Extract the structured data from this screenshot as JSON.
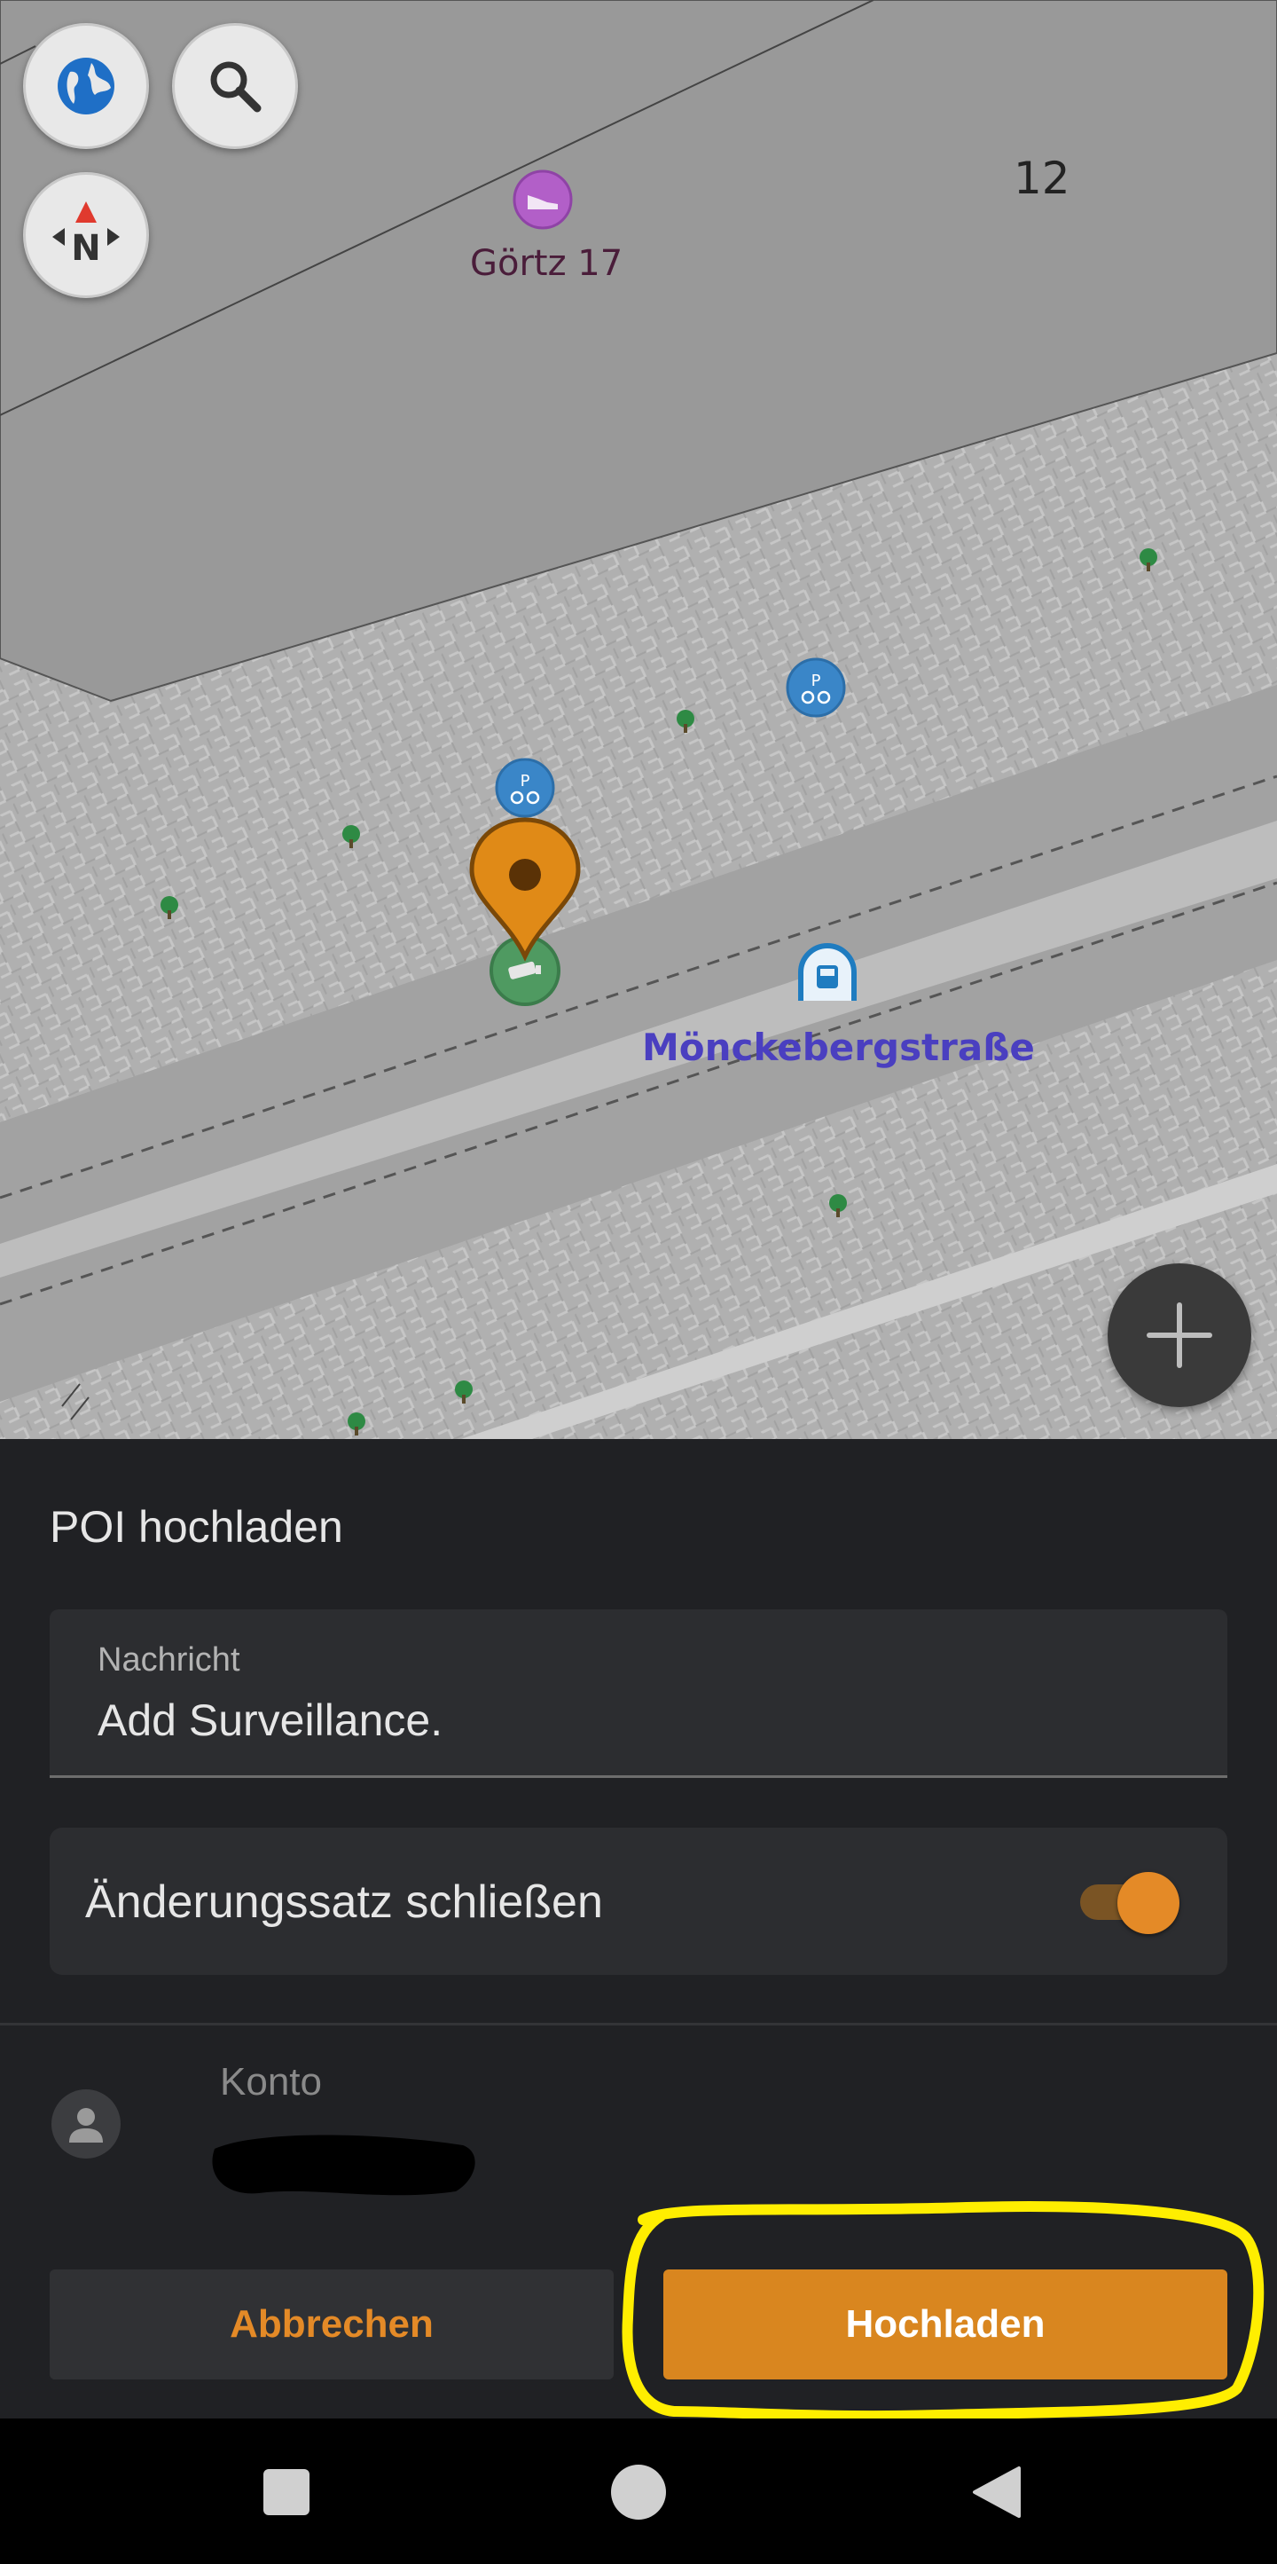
{
  "map": {
    "zoom_level": "12",
    "poi_shop_name": "Görtz 17",
    "station_name": "Mönckebergstraße",
    "controls": {
      "layers_icon": "globe-icon",
      "search_icon": "search-icon",
      "compass_icon": "compass-icon",
      "add_icon": "plus-icon"
    }
  },
  "sheet": {
    "title": "POI hochladen",
    "message_field": {
      "label": "Nachricht",
      "value": "Add Surveillance."
    },
    "close_changeset": {
      "label": "Änderungssatz schließen",
      "enabled": true
    },
    "account": {
      "label": "Konto"
    },
    "buttons": {
      "cancel": "Abbrechen",
      "upload": "Hochladen"
    }
  },
  "colors": {
    "accent": "#e48a27",
    "station_label": "#4a3fc0",
    "highlight": "#ffee00"
  }
}
